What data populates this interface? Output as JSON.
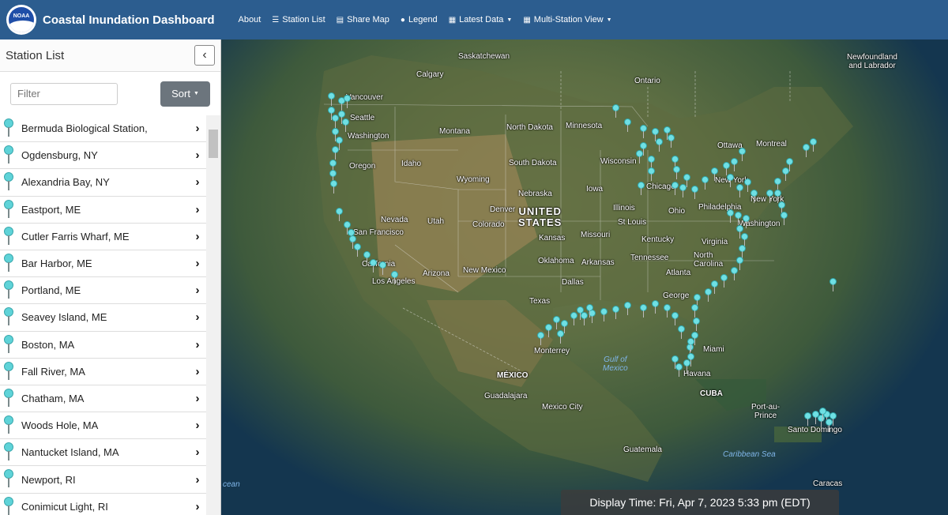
{
  "header": {
    "logo_text": "NOAA",
    "title": "Coastal Inundation Dashboard",
    "nav": [
      {
        "label": "About",
        "icon": "none"
      },
      {
        "label": "Station List",
        "icon": "list-icon"
      },
      {
        "label": "Share Map",
        "icon": "map-icon"
      },
      {
        "label": "Legend",
        "icon": "lightbulb-icon"
      },
      {
        "label": "Latest Data",
        "icon": "table-icon",
        "dropdown": true
      },
      {
        "label": "Multi-Station View",
        "icon": "table-icon",
        "dropdown": true
      }
    ]
  },
  "sidebar": {
    "title": "Station List",
    "collapse_icon": "chevron-left-icon",
    "filter_placeholder": "Filter",
    "sort_label": "Sort",
    "stations": [
      "Bermuda Biological Station,",
      "Ogdensburg, NY",
      "Alexandria Bay, NY",
      "Eastport, ME",
      "Cutler Farris Wharf, ME",
      "Bar Harbor, ME",
      "Portland, ME",
      "Seavey Island, ME",
      "Boston, MA",
      "Fall River, MA",
      "Chatham, MA",
      "Woods Hole, MA",
      "Nantucket Island, MA",
      "Newport, RI",
      "Conimicut Light, RI"
    ]
  },
  "map": {
    "labels": {
      "saskatchewan": "Saskatchewan",
      "calgary": "Calgary",
      "ontario": "Ontario",
      "newfoundland": "Newfoundland\nand Labrador",
      "vancouver": "Vancouver",
      "seattle": "Seattle",
      "washington": "Washington",
      "montana": "Montana",
      "north_dakota": "North Dakota",
      "minnesota": "Minnesota",
      "ottawa": "Ottawa",
      "montreal": "Montreal",
      "oregon": "Oregon",
      "idaho": "Idaho",
      "wyoming": "Wyoming",
      "south_dakota": "South Dakota",
      "wisconsin": "Wisconsin",
      "new_york": "New York",
      "iowa": "Iowa",
      "chicago": "Chicago",
      "nebraska": "Nebraska",
      "nevada": "Nevada",
      "utah": "Utah",
      "denver": "Denver",
      "colorado": "Colorado",
      "united_states": "UNITED\nSTATES",
      "illinois": "Illinois",
      "ohio": "Ohio",
      "philadelphia": "Philadelphia",
      "new_york_city": "New York",
      "san_francisco": "San Francisco",
      "kansas": "Kansas",
      "missouri": "Missouri",
      "st_louis": "St Louis",
      "washington_dc": "Washington",
      "virginia": "Virginia",
      "kentucky": "Kentucky",
      "california": "California",
      "los_angeles": "Los Angeles",
      "arizona": "Arizona",
      "new_mexico": "New Mexico",
      "oklahoma": "Oklahoma",
      "arkansas": "Arkansas",
      "tennessee": "Tennessee",
      "north_carolina": "North\nCarolina",
      "atlanta": "Atlanta",
      "dallas": "Dallas",
      "texas": "Texas",
      "georgia": "George",
      "monterrey": "Monterrey",
      "gulf": "Gulf of\nMexico",
      "miami": "Miami",
      "mexico": "MÉXICO",
      "havana": "Havana",
      "cuba": "CUBA",
      "guadalajara": "Guadalajara",
      "mexico_city": "Mexico City",
      "port_au_prince": "Port-au-\nPrince",
      "santo_domingo": "Santo Domingo",
      "guatemala": "Guatemala",
      "caribbean": "Caribbean Sea",
      "caracas": "Caracas",
      "ocean": "cean"
    },
    "display_time": "Display Time: Fri, Apr 7, 2023 5:33 pm (EDT)",
    "marker_color": "#6fe0e4"
  }
}
